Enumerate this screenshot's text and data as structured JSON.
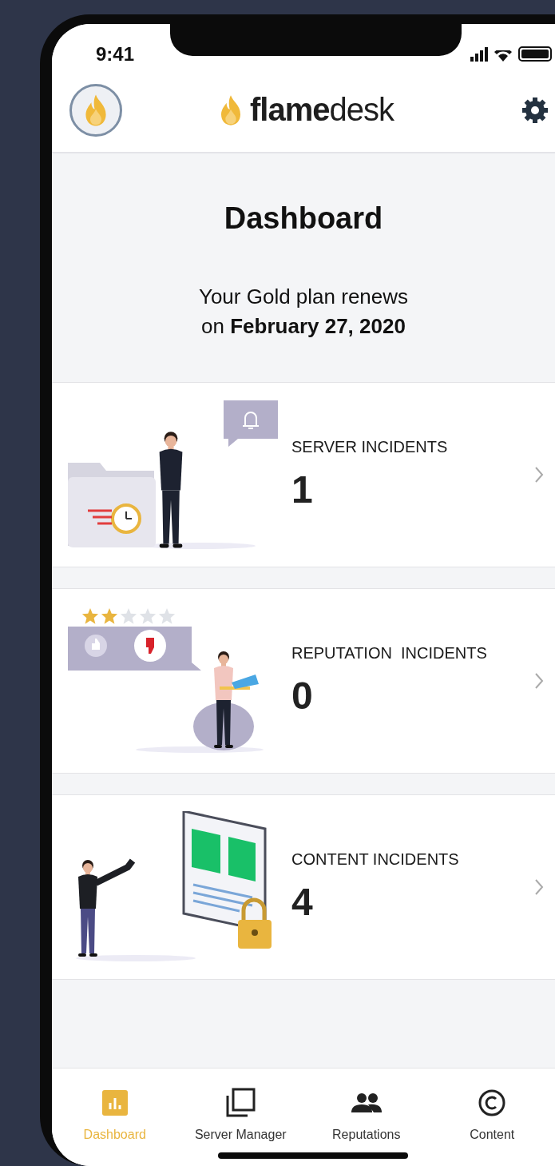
{
  "status_bar": {
    "time": "9:41"
  },
  "header": {
    "logo_bold": "flame",
    "logo_light": "desk"
  },
  "hero": {
    "title": "Dashboard",
    "subtitle": "Your Gold plan renews\non **February 27, 2020**"
  },
  "cards": [
    {
      "kind": "server",
      "label": "SERVER INCIDENTS",
      "count": "1"
    },
    {
      "kind": "reputation",
      "label": "REPUTATION  INCIDENTS",
      "count": "0",
      "stars": 2
    },
    {
      "kind": "content",
      "label": "CONTENT INCIDENTS",
      "count": "4"
    }
  ],
  "tabs": [
    {
      "kind": "chart",
      "label": "Dashboard",
      "selected": true
    },
    {
      "kind": "copy",
      "label": "Server Manager",
      "selected": false
    },
    {
      "kind": "people",
      "label": "Reputations",
      "selected": false
    },
    {
      "kind": "copyright",
      "label": "Content",
      "selected": false
    }
  ]
}
